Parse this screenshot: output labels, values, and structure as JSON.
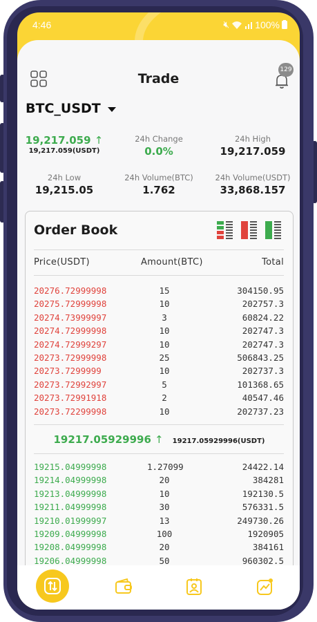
{
  "status_bar": {
    "time": "4:46",
    "battery": "100%"
  },
  "header": {
    "title": "Trade",
    "notification_count": "129"
  },
  "pair": {
    "label": "BTC_USDT"
  },
  "stats": {
    "last_price": "19,217.059",
    "last_price_usdt": "19,217.059(USDT)",
    "change_label": "24h Change",
    "change_value": "0.0%",
    "high_label": "24h High",
    "high_value": "19,217.059",
    "low_label": "24h Low",
    "low_value": "19,215.05",
    "vol_btc_label": "24h Volume(BTC)",
    "vol_btc_value": "1.762",
    "vol_usdt_label": "24h Volume(USDT)",
    "vol_usdt_value": "33,868.157"
  },
  "order_book": {
    "title": "Order Book",
    "columns": {
      "price": "Price(USDT)",
      "amount": "Amount(BTC)",
      "total": "Total"
    },
    "asks": [
      {
        "price": "20276.72999998",
        "amount": "15",
        "total": "304150.95"
      },
      {
        "price": "20275.72999998",
        "amount": "10",
        "total": "202757.3"
      },
      {
        "price": "20274.73999997",
        "amount": "3",
        "total": "60824.22"
      },
      {
        "price": "20274.72999998",
        "amount": "10",
        "total": "202747.3"
      },
      {
        "price": "20274.72999297",
        "amount": "10",
        "total": "202747.3"
      },
      {
        "price": "20273.72999998",
        "amount": "25",
        "total": "506843.25"
      },
      {
        "price": "20273.7299999",
        "amount": "10",
        "total": "202737.3"
      },
      {
        "price": "20273.72992997",
        "amount": "5",
        "total": "101368.65"
      },
      {
        "price": "20273.72991918",
        "amount": "2",
        "total": "40547.46"
      },
      {
        "price": "20273.72299998",
        "amount": "10",
        "total": "202737.23"
      }
    ],
    "mid_price": "19217.05929996",
    "mid_price_usdt": "19217.05929996(USDT)",
    "bids": [
      {
        "price": "19215.04999998",
        "amount": "1.27099",
        "total": "24422.14"
      },
      {
        "price": "19214.04999998",
        "amount": "20",
        "total": "384281"
      },
      {
        "price": "19213.04999998",
        "amount": "10",
        "total": "192130.5"
      },
      {
        "price": "19211.04999998",
        "amount": "30",
        "total": "576331.5"
      },
      {
        "price": "19210.01999997",
        "amount": "13",
        "total": "249730.26"
      },
      {
        "price": "19209.04999998",
        "amount": "100",
        "total": "1920905"
      },
      {
        "price": "19208.04999998",
        "amount": "20",
        "total": "384161"
      },
      {
        "price": "19206.04999998",
        "amount": "50",
        "total": "960302.5"
      }
    ]
  },
  "colors": {
    "accent": "#f7c81e",
    "buy": "#3dab4e",
    "sell": "#e0433c"
  },
  "nav": {
    "items": [
      "trade-icon",
      "wallet-icon",
      "profile-icon",
      "chart-icon"
    ]
  }
}
